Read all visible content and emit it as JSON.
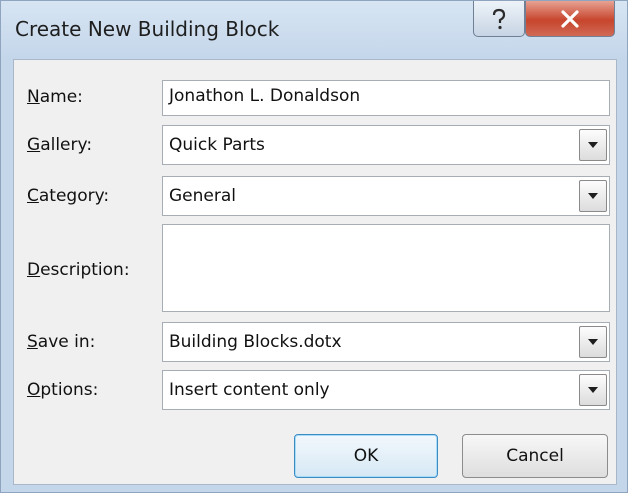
{
  "dialog": {
    "title": "Create New Building Block"
  },
  "fields": {
    "name": {
      "label_first": "N",
      "label_rest": "ame:",
      "value": "Jonathon L. Donaldson"
    },
    "gallery": {
      "label_first": "G",
      "label_rest": "allery:",
      "value": "Quick Parts"
    },
    "category": {
      "label_first": "C",
      "label_rest": "ategory:",
      "value": "General"
    },
    "description": {
      "label_first": "D",
      "label_rest": "escription:",
      "value": ""
    },
    "save_in": {
      "label_first": "S",
      "label_rest": "ave in:",
      "value": "Building Blocks.dotx"
    },
    "options": {
      "label_first": "O",
      "label_rest": "ptions:",
      "value": "Insert content only"
    }
  },
  "buttons": {
    "ok": "OK",
    "cancel": "Cancel"
  },
  "icons": {
    "help": "help-icon",
    "close": "close-icon",
    "dropdown": "dropdown-arrow-icon"
  },
  "colors": {
    "frame": "#c4d6ea",
    "close_button": "#c7452d",
    "ok_border": "#3c8cc4"
  }
}
